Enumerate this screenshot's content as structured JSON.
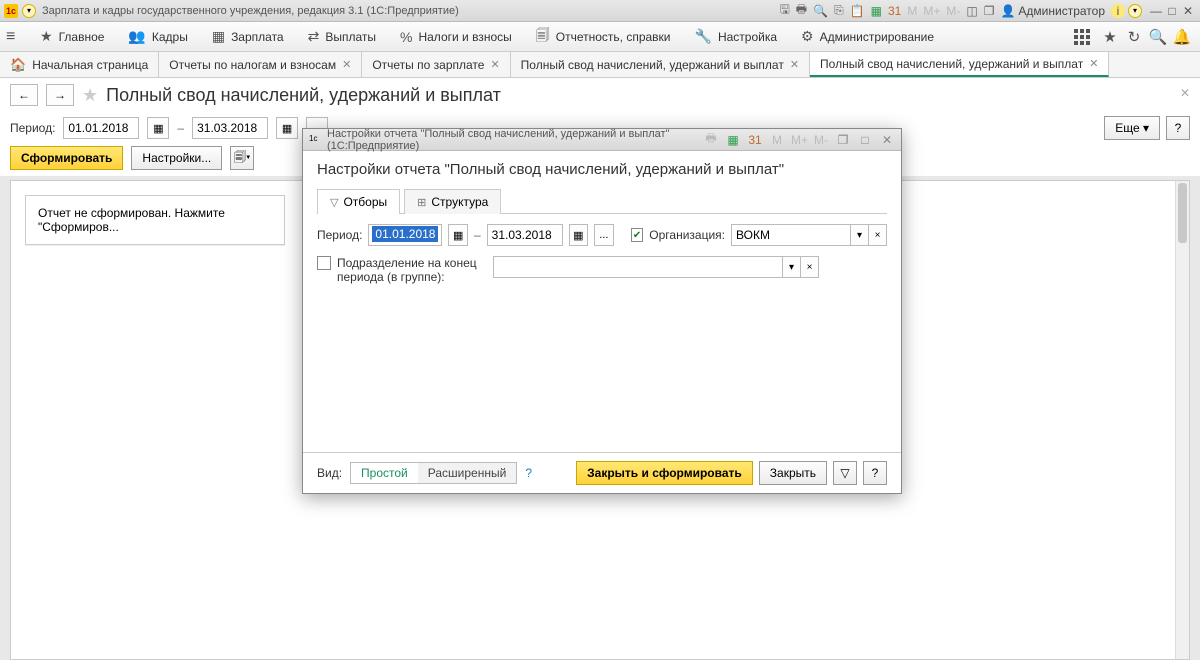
{
  "titlebar": {
    "app_title": "Зарплата и кадры государственного учреждения, редакция 3.1  (1С:Предприятие)",
    "admin_label": "Администратор",
    "calc_labels": [
      "M",
      "M+",
      "M-"
    ]
  },
  "menu": {
    "items": [
      {
        "icon": "★",
        "label": "Главное"
      },
      {
        "icon": "👥",
        "label": "Кадры"
      },
      {
        "icon": "▦",
        "label": "Зарплата"
      },
      {
        "icon": "⇄",
        "label": "Выплаты"
      },
      {
        "icon": "%",
        "label": "Налоги и взносы"
      },
      {
        "icon": "🗐",
        "label": "Отчетность, справки"
      },
      {
        "icon": "🔧",
        "label": "Настройка"
      },
      {
        "icon": "⚙",
        "label": "Администрирование"
      }
    ]
  },
  "tabs": {
    "items": [
      {
        "label": "Начальная страница",
        "home": true,
        "closable": false
      },
      {
        "label": "Отчеты по налогам и взносам",
        "closable": true
      },
      {
        "label": "Отчеты по зарплате",
        "closable": true
      },
      {
        "label": "Полный свод начислений, удержаний и выплат",
        "closable": true
      },
      {
        "label": "Полный свод начислений, удержаний и выплат",
        "closable": true,
        "active": true
      }
    ]
  },
  "page": {
    "title": "Полный свод начислений, удержаний и выплат",
    "period_label": "Период:",
    "date_from": "01.01.2018",
    "date_to": "31.03.2018",
    "dash": "–",
    "dots": "...",
    "form_btn": "Сформировать",
    "settings_btn": "Настройки...",
    "more_btn": "Еще",
    "help_btn": "?",
    "stub_text": "Отчет не сформирован. Нажмите \"Сформиров..."
  },
  "modal": {
    "title": "Настройки отчета \"Полный свод начислений, удержаний и выплат\"  (1С:Предприятие)",
    "heading": "Настройки отчета \"Полный свод начислений, удержаний и выплат\"",
    "tabs": [
      {
        "label": "Отборы",
        "active": true
      },
      {
        "label": "Структура"
      }
    ],
    "period_label": "Период:",
    "date_from": "01.01.2018",
    "date_to": "31.03.2018",
    "dash": "–",
    "dots": "...",
    "org_label": "Организация:",
    "org_value": "ВОКМ",
    "org_checked": true,
    "subdiv_label": "Подразделение на конец периода (в группе):",
    "subdiv_checked": false,
    "view_label": "Вид:",
    "view_simple": "Простой",
    "view_advanced": "Расширенный",
    "help": "?",
    "apply_btn": "Закрыть и сформировать",
    "close_btn": "Закрыть"
  }
}
